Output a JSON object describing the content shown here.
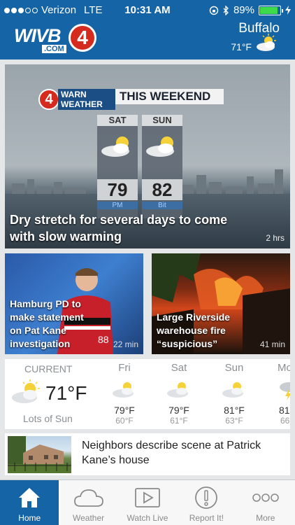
{
  "status_bar": {
    "carrier": "Verizon",
    "network": "LTE",
    "time": "10:31 AM",
    "battery": "89%",
    "battery_level": 0.89
  },
  "header": {
    "logo_text": "WIVB",
    "logo_sub": ".COM",
    "logo_number": "4",
    "city": "Buffalo",
    "temp": "71°F",
    "condition_icon": "partly-sunny-icon"
  },
  "hero": {
    "badge_number": "4",
    "badge_text": "WARN WEATHER",
    "banner": "THIS WEEKEND",
    "days": [
      {
        "name": "SAT",
        "temp": "79",
        "sub": "PM"
      },
      {
        "name": "SUN",
        "temp": "82",
        "sub": "Bit"
      }
    ],
    "headline": "Dry stretch for several days to come with slow warming",
    "age": "2 hrs"
  },
  "cards": [
    {
      "headline": "Hamburg PD to make statement on Pat Kane investigation",
      "age": "22 min"
    },
    {
      "headline": "Large Riverside warehouse fire “suspicious”",
      "age": "41 min"
    }
  ],
  "weather": {
    "current_label": "CURRENT",
    "current_temp": "71°F",
    "current_condition": "Lots of Sun",
    "forecast": [
      {
        "day": "Fri",
        "hi": "79°F",
        "lo": "60°F",
        "icon": "partly-sunny-icon"
      },
      {
        "day": "Sat",
        "hi": "79°F",
        "lo": "61°F",
        "icon": "partly-sunny-icon"
      },
      {
        "day": "Sun",
        "hi": "81°F",
        "lo": "63°F",
        "icon": "partly-sunny-icon"
      },
      {
        "day": "Mo",
        "hi": "81",
        "lo": "66",
        "icon": "storm-icon"
      }
    ]
  },
  "story": {
    "headline": "Neighbors describe scene at Patrick Kane’s house"
  },
  "tabs": [
    {
      "label": "Home",
      "icon": "home-icon",
      "active": true
    },
    {
      "label": "Weather",
      "icon": "cloud-icon",
      "active": false
    },
    {
      "label": "Watch Live",
      "icon": "play-icon",
      "active": false
    },
    {
      "label": "Report It!",
      "icon": "alert-icon",
      "active": false
    },
    {
      "label": "More",
      "icon": "more-icon",
      "active": false
    }
  ],
  "colors": {
    "brand_blue": "#1564a6",
    "brand_red": "#d52b1e",
    "battery_green": "#3ddb4a"
  }
}
